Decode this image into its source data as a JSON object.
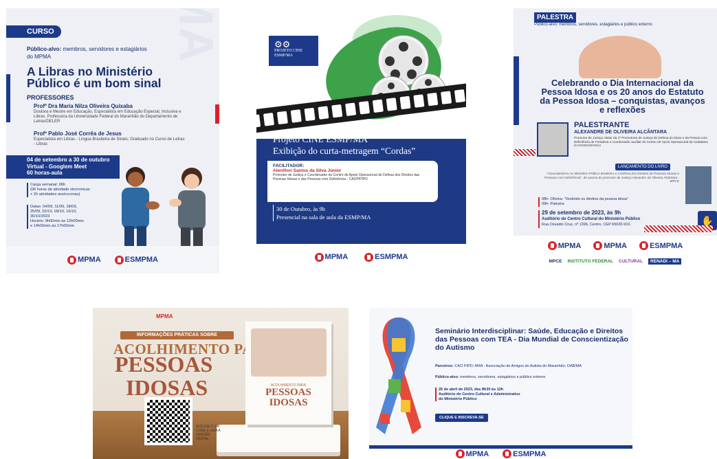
{
  "cards": [
    {
      "tag": "CURSO",
      "publico_label": "Público-alvo:",
      "publico_text": " membros, servidores e estagiários do MPMA",
      "title": "A Libras no Ministério Público é um bom sinal",
      "professores_heading": "PROFESSORES",
      "prof1_name": "Profª Dra Maria Nilza Oliveira Quixaba",
      "prof1_desc": "Doutora e Mestre em Educação, Especialista em Educação Especial, Inclusiva e Libras. Professora da Universidade Federal do Maranhão do Departamento de Letras/DELER",
      "prof2_name": "Profº Pablo José Corrêa de Jesus",
      "prof2_desc": "Especialista em Libras - Língua Brasileira de Sinais; Graduado no Curso de Letras - Libras",
      "date_line1": "04 de setembro a 30 de outubro",
      "date_line2": "Virtual - Googlem Meet",
      "date_line3": "60 horas-aula",
      "carga1": "Carga semanal: 06h",
      "carga2": "(06 horas de atividade síncronicas",
      "carga3": "+ 2h atividades assíncronas)",
      "datas1": "Datas: 04/09, 11/09, 18/09,",
      "datas2": "25/09, 02/10, 09/10, 16/10,",
      "datas3": "30/10/2023",
      "horario1": "Horário: 9h00min às 12h00min",
      "horario2": "e 14h00min às 17h00min",
      "watermark": "ESMPMA"
    },
    {
      "proj_label": "PROJETO CINE ESMP/MA",
      "title1": "Projeto CINE ESMP/MA",
      "title2": "Exibição do curta-metragem “Cordas”",
      "fac_label": "FACILITADOR:",
      "fac_name": "Alenilton Santos da Silva Júnior",
      "fac_desc": "Promotor de Justiça e Coordenador do Centro de Apoio Operacional de Defesa dos Direitos das Pessoas Idosas e das Pessoas com Deficiência - CAOP/PIPD",
      "when1": "30 de Outubro, às 9h",
      "when2": "Presencial na sala de aula da ESMP/MA"
    },
    {
      "tag": "PALESTRA",
      "publico": "Público-alvo: membros, servidores, estagiários e público externo",
      "title": "Celebrando o Dia Internacional da Pessoa Idosa e os 20 anos do Estatuto da Pessoa Idosa – conquistas, avanços e reflexões",
      "palestrante_label": "PALESTRANTE",
      "palestrante_name": "ALEXANDRE DE OLIVEIRA ALCÂNTARA",
      "palestrante_desc": "Promotor de Justiça, titular da 1ª Promotoria de Justiça de Defesa do Idoso e da Pessoa com Deficiência de Fortaleza e coordenador auxiliar do Centro de Apoio Operacional da Cidadania (CAOCIDADANIA)",
      "lancamento": "LANÇAMENTO DO LIVRO",
      "livro_desc": "\"Associativismo no Ministério Público Brasileiro e a Defesa dos Direitos de Pessoas Idosas e Pessoas com Deficiência\", de autoria do promotor de Justiça Alexandre de Oliveira Alcântara - MPCE",
      "sched1": "08h- Oficina: \"Vestindo os direitos da pessoa idosa\"",
      "sched2": "09h- Palestra",
      "date": "29 de setembro de 2023, às 9h",
      "local": "Auditório do Centro Cultural do Ministério Público",
      "addr": "Rua Osvaldo Cruz, nº 1396, Centro, CEP 65020-910.",
      "partner_logos": [
        "MPCE",
        "INSTITUTO FEDERAL",
        "CULTURAL",
        "RENADI – MA"
      ]
    },
    {
      "small_logo": "MPMA",
      "ribbon_text": "INFORMAÇÕES PRÁTICAS SOBRE",
      "title_a": "ACOLHIMENTO PARA",
      "title_b": "PESSOAS",
      "title_c": "IDOSAS",
      "qr_text": "ACESSE O QR CODE E LEIA A VERSÃO DIGITAL",
      "book_title_a": "ACOLHIMENTO PARA",
      "book_title_b": "PESSOAS IDOSAS"
    },
    {
      "title": "Seminário Interdisciplinar: Saúde, Educação e Direitos das Pessoas com TEA - Dia Mundial de Conscientização do Autismo",
      "parceiros_label": "Parceiros:",
      "parceiros_text": " CAO PIPD; AMA - Associação de Amigos do Autista do Maranhão; OAB/MA",
      "publico_label": "Público-alvo:",
      "publico_text": " membros, servidores, estagiários e público externo",
      "date1": "26 de abril de 2023, das 8h30 às 12h",
      "date2": "Auditório do Centro Cultural e Administrativo",
      "date3": "do Ministério Público",
      "button": "CLIQUE E INSCREVA-SE"
    }
  ],
  "logos": {
    "mpma": "MPMA",
    "esmpma": "ESMPMA"
  },
  "colors": {
    "navy": "#1d3a8a",
    "red": "#d9262e",
    "green": "#3da24a",
    "brown": "#a8563a"
  }
}
